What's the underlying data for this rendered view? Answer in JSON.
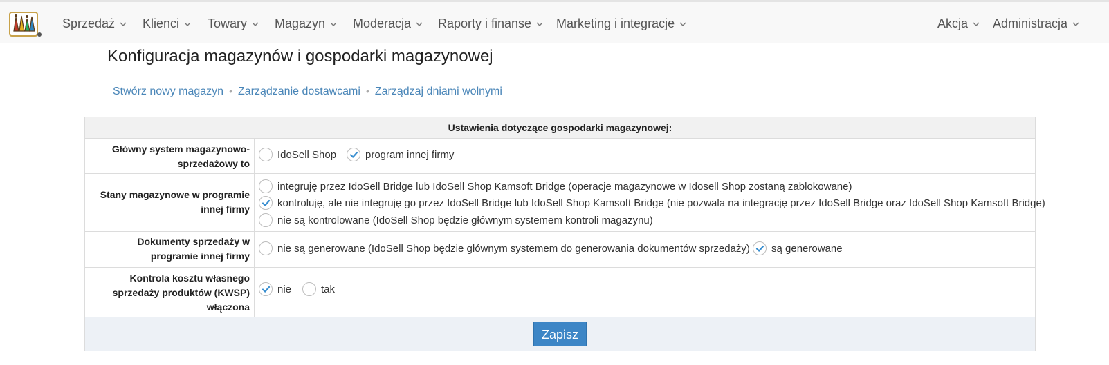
{
  "nav": {
    "left": [
      {
        "label": "Sprzedaż"
      },
      {
        "label": "Klienci"
      },
      {
        "label": "Towary"
      },
      {
        "label": "Magazyn"
      },
      {
        "label": "Moderacja"
      },
      {
        "label": "Raporty i finanse"
      },
      {
        "label": "Marketing i integracje"
      }
    ],
    "right": [
      {
        "label": "Akcja"
      },
      {
        "label": "Administracja"
      }
    ]
  },
  "page": {
    "title": "Konfiguracja magazynów i gospodarki magazynowej",
    "links": [
      "Stwórz nowy magazyn",
      "Zarządzanie dostawcami",
      "Zarządzaj dniami wolnymi"
    ]
  },
  "settings": {
    "header": "Ustawienia dotyczące gospodarki magazynowej:",
    "rows": [
      {
        "label_lines": [
          "Główny system magazynowo-",
          "sprzedażowy to"
        ],
        "options": [
          {
            "label": "IdoSell Shop",
            "checked": false
          },
          {
            "label": "program innej firmy",
            "checked": true
          }
        ]
      },
      {
        "label_lines": [
          "Stany magazynowe w programie",
          "innej firmy"
        ],
        "options": [
          {
            "label": "integruję przez IdoSell Bridge lub IdoSell Shop Kamsoft Bridge (operacje magazynowe w Idosell Shop zostaną zablokowane)",
            "checked": false
          },
          {
            "label": "kontroluję, ale nie integruję go przez IdoSell Bridge lub IdoSell Shop Kamsoft Bridge (nie pozwala na integrację przez IdoSell Bridge oraz IdoSell Shop Kamsoft Bridge)",
            "checked": true
          },
          {
            "label": "nie są kontrolowane (IdoSell Shop będzie głównym systemem kontroli magazynu)",
            "checked": false
          }
        ]
      },
      {
        "label_lines": [
          "Dokumenty sprzedaży w",
          "programie innej firmy"
        ],
        "options": [
          {
            "label": "nie są generowane (IdoSell Shop będzie głównym systemem do generowania dokumentów sprzedaży)",
            "checked": false
          },
          {
            "label": "są generowane",
            "checked": true
          }
        ]
      },
      {
        "label_lines": [
          "Kontrola kosztu własnego",
          "sprzedaży produktów (KWSP)",
          "włączona"
        ],
        "options": [
          {
            "label": "nie",
            "checked": true
          },
          {
            "label": "tak",
            "checked": false
          }
        ]
      }
    ],
    "save_label": "Zapisz"
  },
  "colors": {
    "accent": "#3d86c6",
    "check": "#3a8fd0",
    "link": "#4a86b8"
  }
}
